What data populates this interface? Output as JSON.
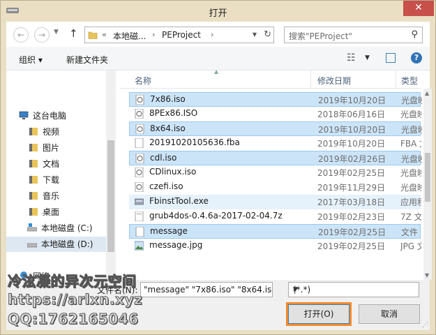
{
  "window": {
    "title": "打开",
    "close_glyph": "✕"
  },
  "nav": {
    "back_glyph": "←",
    "forward_glyph": "→",
    "up_glyph": "↑",
    "address": {
      "prefix": "«",
      "crumbs": [
        "本地磁...",
        "PEProject"
      ],
      "dropdown_glyph": "▼",
      "refresh_glyph": "↻"
    },
    "search": {
      "placeholder": "搜索\"PEProject\"",
      "icon_glyph": "⚲"
    }
  },
  "toolbar": {
    "organize_label": "组织 ▾",
    "new_folder_label": "新建文件夹",
    "view_glyph": "☷",
    "view_dropdown_glyph": "▼",
    "help_glyph": "?"
  },
  "sidebar": {
    "items": [
      {
        "label": "这台电脑",
        "icon": "computer-icon"
      },
      {
        "label": "视频",
        "icon": "video-folder-icon"
      },
      {
        "label": "图片",
        "icon": "pictures-folder-icon"
      },
      {
        "label": "文档",
        "icon": "documents-folder-icon"
      },
      {
        "label": "下载",
        "icon": "downloads-folder-icon"
      },
      {
        "label": "音乐",
        "icon": "music-folder-icon"
      },
      {
        "label": "桌面",
        "icon": "desktop-folder-icon"
      },
      {
        "label": "本地磁盘 (C:)",
        "icon": "drive-c-icon"
      },
      {
        "label": "本地磁盘 (D:)",
        "icon": "drive-d-icon",
        "selected": true
      },
      {
        "label": "网络",
        "icon": "network-icon"
      }
    ]
  },
  "columns": {
    "name": "名称",
    "date": "修改日期",
    "type": "类型"
  },
  "files": [
    {
      "name": "7x86.iso",
      "date": "2019年10月20日",
      "type": "光盘映",
      "selected": true,
      "icon": "disc-image-icon"
    },
    {
      "name": "8PEx86.ISO",
      "date": "2018年06月16日",
      "type": "光盘映",
      "selected": false,
      "icon": "disc-image-icon"
    },
    {
      "name": "8x64.iso",
      "date": "2019年10月20日",
      "type": "光盘映",
      "selected": true,
      "icon": "disc-image-icon"
    },
    {
      "name": "20191020105636.fba",
      "date": "2019年10月20日",
      "type": "FBA 文",
      "selected": false,
      "icon": "file-icon"
    },
    {
      "name": "cdl.iso",
      "date": "2019年02月26日",
      "type": "光盘映",
      "selected": true,
      "icon": "disc-image-icon"
    },
    {
      "name": "CDlinux.iso",
      "date": "2019年02月25日",
      "type": "光盘映",
      "selected": false,
      "icon": "disc-image-icon"
    },
    {
      "name": "czefi.iso",
      "date": "2019年11月29日",
      "type": "光盘映",
      "selected": false,
      "icon": "disc-image-icon"
    },
    {
      "name": "FbinstTool.exe",
      "date": "2017年03月18日",
      "type": "应用程",
      "selected": false,
      "hover": true,
      "icon": "exe-icon"
    },
    {
      "name": "grub4dos-0.4.6a-2017-02-04.7z",
      "date": "2019年02月23日",
      "type": "7Z 文",
      "selected": false,
      "icon": "archive-icon"
    },
    {
      "name": "message",
      "date": "2019年02月25日",
      "type": "文件",
      "selected": true,
      "icon": "file-icon"
    },
    {
      "name": "message.jpg",
      "date": "2019年02月25日",
      "type": "JPG 文",
      "selected": false,
      "icon": "image-file-icon"
    }
  ],
  "footer": {
    "filename_label": "文件名(N):",
    "filename_value": "\"message\" \"7x86.iso\" \"8x64.iso",
    "filetype_value": "(*.*)",
    "filetype_dropdown_glyph": "▼",
    "open_label": "打开(O)",
    "cancel_label": "取消"
  },
  "watermark": {
    "line1": "冷泫凝的异次元空间",
    "line2": "https://arlxn.xyz",
    "line3": "QQ:1762165046"
  },
  "colors": {
    "selection": "#cce4f7",
    "accent": "#f08a2c",
    "close": "#c7504b"
  }
}
